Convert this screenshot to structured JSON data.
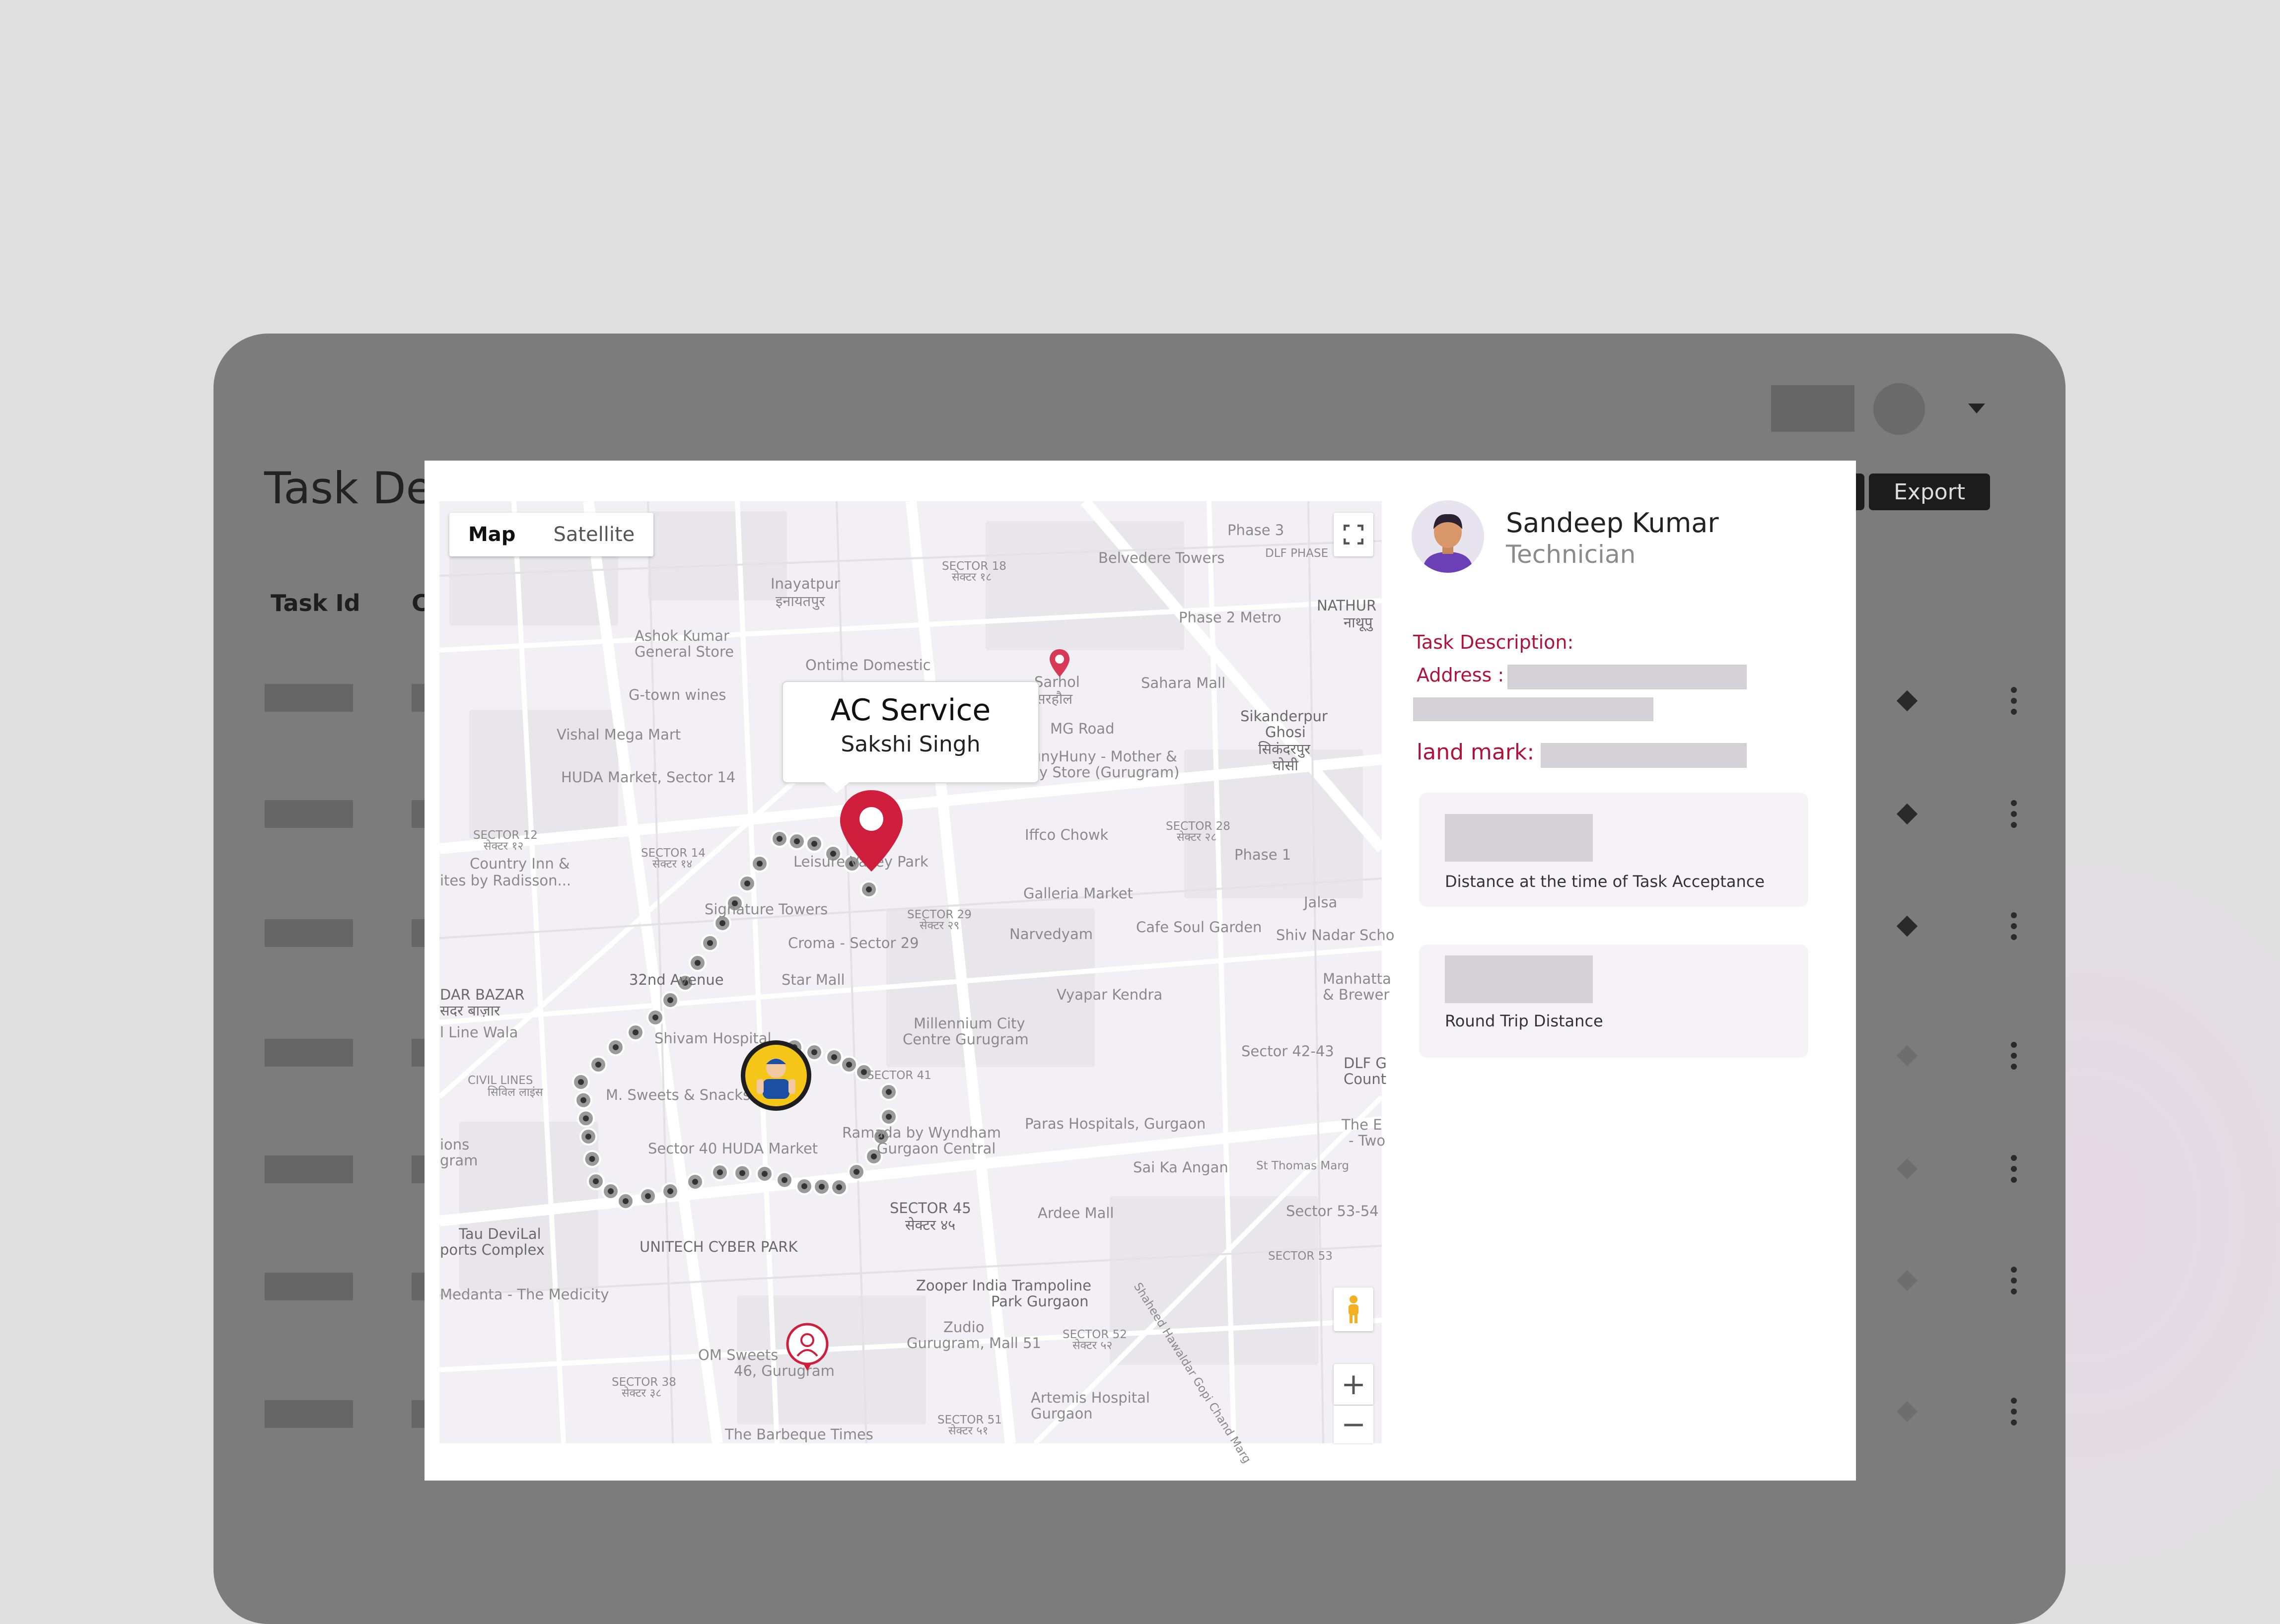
{
  "page": {
    "title": "Task Det",
    "export_label": "Export",
    "columns": [
      "Task Id",
      "C"
    ]
  },
  "map": {
    "map_types": [
      "Map",
      "Satellite"
    ],
    "active_map_type": "Map",
    "callout": {
      "title": "AC Service",
      "subtitle": "Sakshi Singh"
    },
    "zoom_in": "+",
    "zoom_out": "−",
    "labels": {
      "inayatpur": "Inayatpur",
      "inayatpur_hi": "इनायतपुर",
      "ashok": "Ashok Kumar",
      "ashok2": "General Store",
      "ontime": "Ontime Domestic",
      "sarhol": "Sarhol",
      "sarhol_hi": "सरहौल",
      "gtown": "G-town wines",
      "sahara": "Sahara Mall",
      "sikanderpur": "Sikanderpur",
      "ghosi": "Ghosi",
      "sikanderpur_hi": "सिकंदरपुर",
      "ghosi_hi": "घोसी",
      "vishal": "Vishal Mega Mart",
      "mgroad": "MG Road",
      "huda": "HUDA Market, Sector 14",
      "hunny": "unyHuny - Mother &",
      "hunny2": "y Store (Gurugram)",
      "sector18": "SECTOR 18",
      "sector18_hi": "सेक्टर १८",
      "belvedere": "Belvedere Towers",
      "phase3": "Phase 3",
      "dlf": "DLF PHASE",
      "phase2": "Phase 2 Metro",
      "nathur": "NATHUR",
      "nathur_hi": "नाथूपु",
      "sector12": "SECTOR 12",
      "sector12_hi": "सेक्टर १२",
      "sector14": "SECTOR 14",
      "sector14_hi": "सेक्टर १४",
      "country": "Country Inn &",
      "country2": "ites by Radisson...",
      "leisure": "Leisure Valley Park",
      "iffco": "Iffco Chowk",
      "sector28": "SECTOR 28",
      "sector28_hi": "सेक्टर २८",
      "phase1": "Phase 1",
      "galleria": "Galleria Market",
      "signature": "Signature Towers",
      "sector29": "SECTOR 29",
      "sector29_hi": "सेक्टर २९",
      "narvedyam": "Narvedyam",
      "cafesoul": "Cafe Soul Garden",
      "jalsa": "Jalsa",
      "shivnadar": "Shiv Nadar Scho",
      "croma": "Croma - Sector 29",
      "avenue": "32nd Avenue",
      "starmall": "Star Mall",
      "darbazar": "DAR BAZAR",
      "darbazar_hi": "सदर बाज़ार",
      "vyapar": "Vyapar Kendra",
      "manhattan": "Manhatta",
      "brewer": "& Brewer",
      "millennium": "Millennium City",
      "millennium2": "Centre Gurugram",
      "linewala": "l Line Wala",
      "shivam": "Shivam Hospital",
      "sector4243": "Sector 42-43",
      "dlfcount": "DLF G",
      "count": "Count",
      "civil": "CIVIL LINES",
      "civil_hi": "सिविल लाइंस",
      "sweets": "M. Sweets & Snacks",
      "sector41": "SECTOR 41",
      "ramada": "Ramada by Wyndham",
      "ramada2": "Gurgaon Central",
      "paras": "Paras Hospitals, Gurgaon",
      "thee": "The E",
      "two": "- Two",
      "sector40": "Sector 40 HUDA Market",
      "stthomas": "St Thomas Marg",
      "saika": "Sai Ka Angan",
      "ions": "ions",
      "gram": "gram",
      "sector45": "SECTOR 45",
      "sector45_hi": "सेक्टर ४५",
      "ardee": "Ardee Mall",
      "sector5354": "Sector 53-54",
      "taudevilal": "Tau DeviLal",
      "ports": "ports Complex",
      "unitech": "UNITECH CYBER PARK",
      "sector53": "SECTOR 53",
      "medanta": "Medanta - The Medicity",
      "zooper": "Zooper India Trampoline",
      "zooper2": "Park Gurgaon",
      "zudio": "Zudio",
      "zudio2": "Gurugram, Mall 51",
      "sector52": "SECTOR 52",
      "sector52_hi": "सेक्टर ५२",
      "omsweets": "OM Sweets",
      "omsweets2": "46, Gurugram",
      "sector38": "SECTOR 38",
      "sector38_hi": "सेक्टर ३८",
      "artemis": "Artemis Hospital",
      "artemis2": "Gurgaon",
      "sector51": "SECTOR 51",
      "sector51_hi": "सेक्टर ५१",
      "barbeque": "The Barbeque Times",
      "shaheed": "Shaheed Hawaldar Gopi Chand Marg"
    }
  },
  "panel": {
    "name": "Sandeep Kumar",
    "role": "Technician",
    "task_description_label": "Task Description:",
    "address_label": "Address :",
    "landmark_label": "land mark:",
    "distance_acceptance_label": "Distance at the time of Task Acceptance",
    "round_trip_label": "Round Trip Distance"
  },
  "colors": {
    "accent_red": "#b0133a",
    "pin_red": "#cf1e3c",
    "route_dot": "#8f8f8f",
    "backdrop": "#7c7c7c"
  },
  "icons": [
    "map-pin-icon",
    "technician-marker-icon",
    "fullscreen-icon",
    "pegman-icon",
    "zoom-in-icon",
    "zoom-out-icon",
    "caret-down-icon",
    "action-diamond-icon",
    "kebab-menu-icon"
  ]
}
